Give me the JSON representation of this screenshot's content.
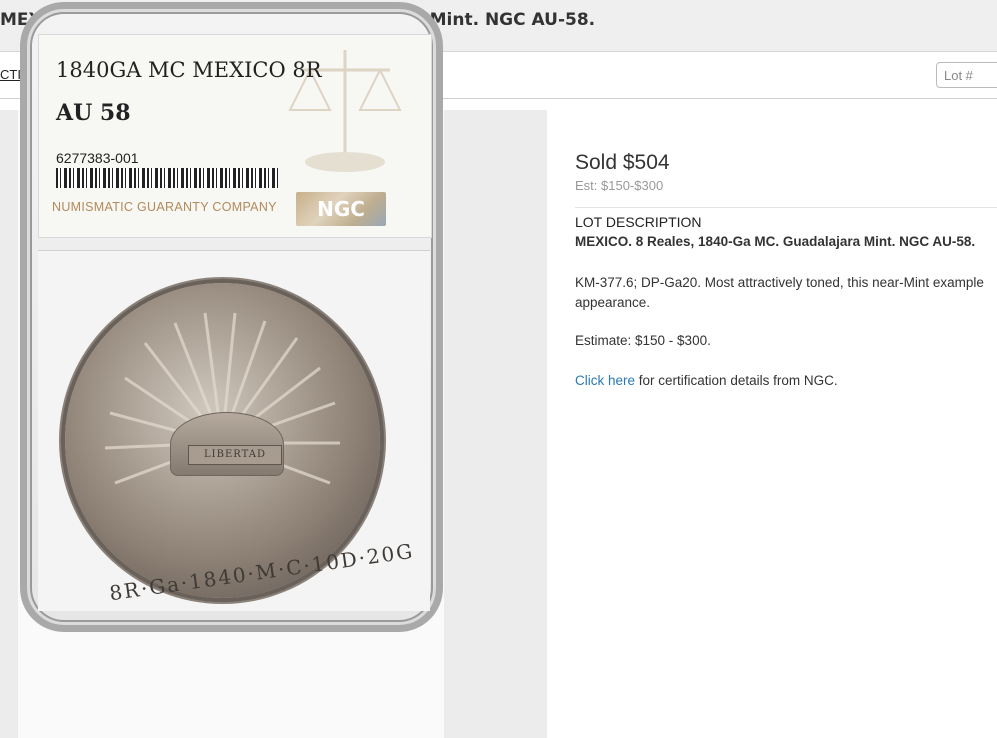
{
  "header": {
    "title": "MEXICO. 8 Reales, 1840-Ga MC. Guadalajara Mint. NGC AU-58."
  },
  "nav": {
    "back_link": "CTION",
    "lot_search_placeholder": "Lot #"
  },
  "slab": {
    "label_line": "1840GA MC MEXICO 8R",
    "grade": "AU 58",
    "cert_number": "6277383-001",
    "company": "NUMISMATIC GUARANTY COMPANY",
    "logo_text": "NGC",
    "coin_banner": "LIBERTAD",
    "coin_legend": "8R·Ga·1840·M·C·10D·20G"
  },
  "lot": {
    "sold_text": "Sold $504",
    "estimate_short": "Est: $150-$300",
    "description_header": "LOT DESCRIPTION",
    "description_title": "MEXICO. 8 Reales, 1840-Ga MC. Guadalajara Mint. NGC AU-58.",
    "description_line1": "KM-377.6; DP-Ga20. Most attractively toned, this near-Mint example",
    "description_line2": "appearance.",
    "estimate_full": "Estimate: $150 - $300.",
    "cert_link": "Click here",
    "cert_text": " for certification details from NGC."
  },
  "colors": {
    "link": "#2a79b5",
    "muted": "#999999",
    "header_bg": "#efefef"
  }
}
